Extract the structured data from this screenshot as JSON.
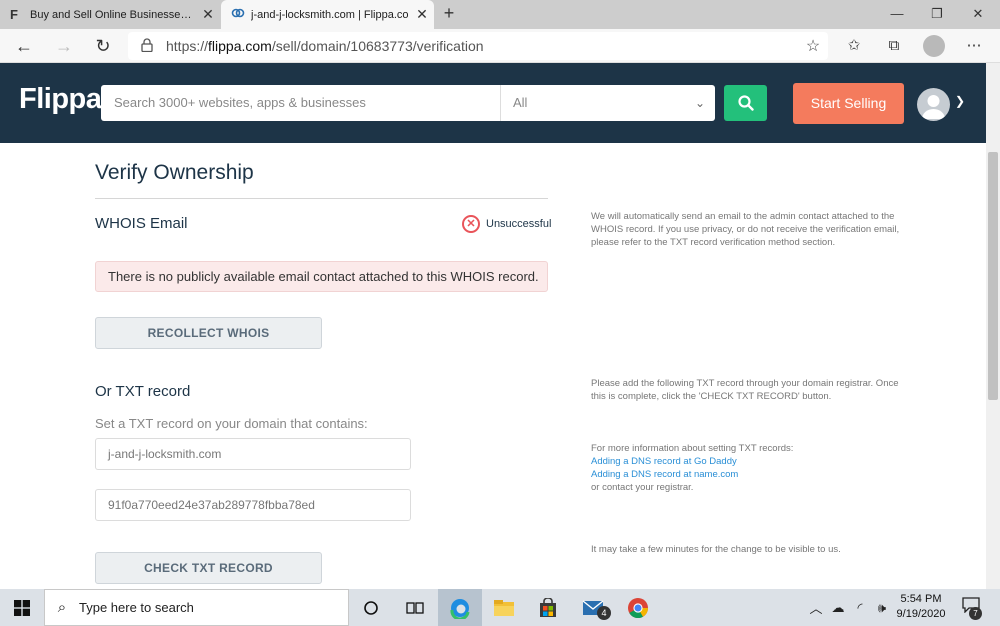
{
  "browser": {
    "tabs": [
      {
        "icon": "F",
        "label": "Buy and Sell Online Businesses, W"
      },
      {
        "icon": "⟳",
        "label": "j-and-j-locksmith.com | Flippa.co"
      }
    ],
    "url_prefix": "https://",
    "url_domain": "flippa.com",
    "url_path": "/sell/domain/10683773/verification"
  },
  "site": {
    "logo": "Flippa",
    "search_placeholder": "Search 3000+ websites, apps & businesses",
    "category_selected": "All",
    "start_selling_label": "Start Selling"
  },
  "page": {
    "title": "Verify Ownership",
    "whois": {
      "heading": "WHOIS Email",
      "status": "Unsuccessful",
      "alert": "There is no publicly available email contact attached to this WHOIS record.",
      "button": "RECOLLECT WHOIS",
      "help": "We will automatically send an email to the admin contact attached to the WHOIS record. If you use privacy, or do not receive the verification email, please refer to the TXT record verification method section."
    },
    "txt": {
      "heading": "Or TXT record",
      "description": "Set a TXT record on your domain that contains:",
      "host_field": "j-and-j-locksmith.com",
      "value_field": "91f0a770eed24e37ab289778fbba78ed",
      "button": "CHECK TXT RECORD",
      "help_add": "Please add the following TXT record through your domain registrar. Once this is complete, click the 'CHECK TXT RECORD' button.",
      "help_more": "For more information about setting TXT records:",
      "link_godaddy": "Adding a DNS record at Go Daddy",
      "link_namecom": "Adding a DNS record at name.com",
      "help_contact": "or contact your registrar.",
      "help_wait": "It may take a few minutes for the change to be visible to us."
    }
  },
  "taskbar": {
    "search_placeholder": "Type here to search",
    "mail_badge": "4",
    "time": "5:54 PM",
    "date": "9/19/2020",
    "notification_count": "7"
  },
  "colors": {
    "header_bg": "#1d3447",
    "search_btn": "#23c07b",
    "start_selling": "#f47b5d",
    "error_red": "#e9545a",
    "link": "#2a8fd6"
  }
}
